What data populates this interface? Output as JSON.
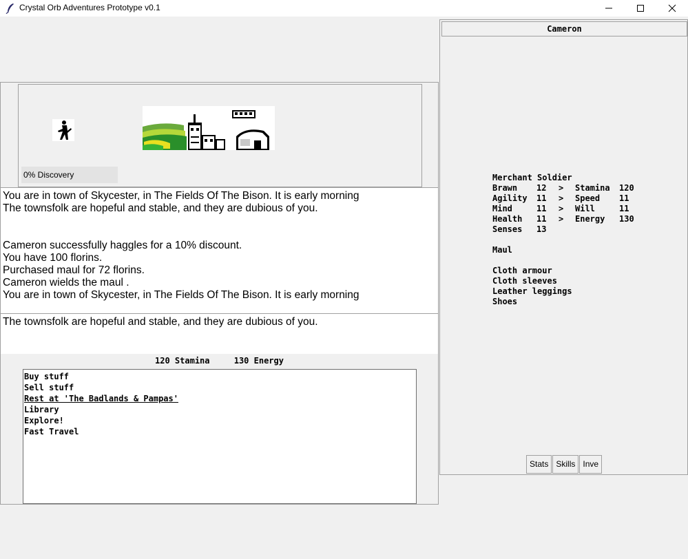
{
  "window": {
    "title": "Crystal Orb Adventures Prototype v0.1"
  },
  "scene": {
    "discovery": "0% Discovery"
  },
  "log": {
    "lines": [
      "You are in town of Skycester, in The Fields Of The Bison. It is early morning",
      "The townsfolk are hopeful and stable, and they are dubious of you.",
      "",
      "",
      "Cameron successfully haggles for a 10% discount.",
      "You have 100 florins.",
      "Purchased maul  for 72 florins.",
      "Cameron wields the maul .",
      "You are in town of Skycester, in The Fields Of The Bison. It is early morning"
    ],
    "secondary": "The townsfolk are hopeful and stable, and they are dubious of you."
  },
  "resources": {
    "stamina": "120 Stamina",
    "energy": "130 Energy"
  },
  "actions": [
    "Buy stuff",
    "Sell stuff",
    "Rest at 'The Badlands & Pampas'",
    "Library",
    "Explore!",
    "Fast Travel"
  ],
  "character": {
    "name": "Cameron",
    "class": "Merchant Soldier",
    "stats": [
      {
        "label": "Brawn",
        "value": "12",
        "arrow": ">",
        "derived_label": "Stamina",
        "derived_value": "120"
      },
      {
        "label": "Agility",
        "value": "11",
        "arrow": ">",
        "derived_label": "Speed",
        "derived_value": "11"
      },
      {
        "label": "Mind",
        "value": "11",
        "arrow": ">",
        "derived_label": "Will",
        "derived_value": "11"
      },
      {
        "label": "Health",
        "value": "11",
        "arrow": ">",
        "derived_label": "Energy",
        "derived_value": "130"
      },
      {
        "label": "Senses",
        "value": "13",
        "arrow": "",
        "derived_label": "",
        "derived_value": ""
      }
    ],
    "weapon": "Maul",
    "armour": [
      "Cloth armour",
      "Cloth sleeves",
      "Leather leggings",
      "Shoes"
    ]
  },
  "tabs": [
    "Stats",
    "Skills",
    "Inve"
  ]
}
